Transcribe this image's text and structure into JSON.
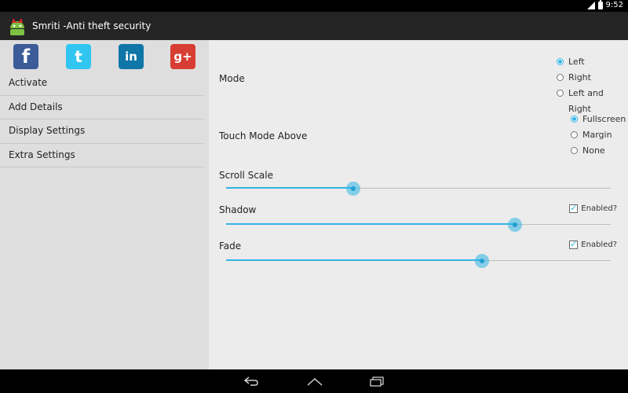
{
  "status_bar": {
    "time": "9:52"
  },
  "app_bar": {
    "title": "Smriti -Anti theft security",
    "icon": "android-icon"
  },
  "social": [
    {
      "glyph": "f",
      "icon": "facebook-icon",
      "color": "#3b5b99"
    },
    {
      "glyph": "t",
      "icon": "twitter-icon",
      "color": "#31c6f1"
    },
    {
      "glyph": "in",
      "icon": "linkedin-icon",
      "color": "#0f76a8"
    },
    {
      "glyph": "g+",
      "icon": "google-plus-icon",
      "color": "#d73d32"
    }
  ],
  "menu": [
    "Activate",
    "Add Details",
    "Display Settings",
    "Extra Settings"
  ],
  "settings": {
    "mode": {
      "label": "Mode",
      "options": [
        "Left",
        "Right",
        "Left and Right"
      ],
      "selected": "Left"
    },
    "touch_mode": {
      "label": "Touch Mode Above",
      "options": [
        "Fullscreen",
        "Margin",
        "None"
      ],
      "selected": "Fullscreen"
    },
    "scroll_scale": {
      "label": "Scroll Scale",
      "value": 0.33
    },
    "shadow": {
      "label": "Shadow",
      "value": 0.75,
      "checkbox_label": "Enabled?",
      "checked": true
    },
    "fade": {
      "label": "Fade",
      "value": 0.665,
      "checkbox_label": "Enabled?",
      "checked": true
    }
  },
  "nav_bar": {
    "back_icon": "back-icon",
    "home_icon": "home-icon",
    "recent_icon": "recent-apps-icon"
  },
  "accent_color": "#33b5e5"
}
